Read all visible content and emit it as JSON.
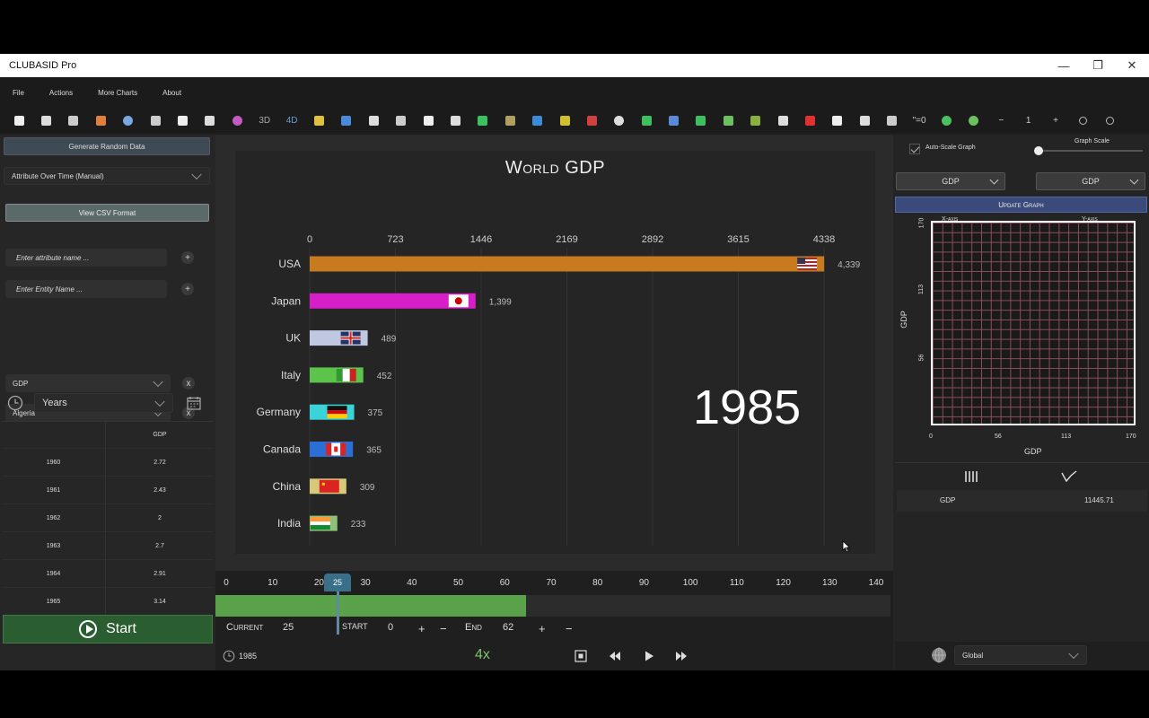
{
  "window": {
    "title": "CLUBASID Pro",
    "minimize": "—",
    "restore": "❐",
    "close": "✕"
  },
  "menu": [
    "File",
    "Actions",
    "More Charts",
    "About"
  ],
  "toolbar": {
    "text_items": {
      "t3d": "3D",
      "t4d": "4D",
      "teq0": "\"=0",
      "zoom_value": "1"
    },
    "icons": [
      "new-file-icon",
      "grid-icon",
      "text-icon",
      "bar-chart-icon",
      "pie-chart-icon",
      "horizontal-bar-icon",
      "axis-icon",
      "line-chart-icon",
      "bubble-icon",
      "3d-icon",
      "4d-icon",
      "stacked-bar-icon",
      "column-icon",
      "scatter-icon",
      "sort-icon",
      "histogram-icon",
      "pentagon-icon",
      "arc-icon",
      "map-icon",
      "bar-up-icon",
      "bar-down-icon",
      "pyramid-icon",
      "donut-icon",
      "range-icon",
      "heatmap-icon",
      "swap-icon",
      "africa-icon",
      "list-icon",
      "note-icon",
      "alert-icon",
      "wave-icon",
      "sigma-icon",
      "image-icon",
      "equals-zero-icon",
      "color-icon",
      "clock-icon",
      "minus-icon",
      "zoom-value",
      "plus-icon",
      "zoom-in-icon",
      "zoom-out-icon"
    ]
  },
  "left": {
    "generate_label": "Generate Random Data",
    "mode_select": "Attribute Over Time (Manual)",
    "csv_label": "View CSV Format",
    "attr_placeholder": "Enter attribute name ...",
    "entity_placeholder": "Enter Entity Name ...",
    "plus": "+",
    "remove": "x",
    "attr_select": "GDP",
    "entity_select": "Algeria",
    "time_unit": "Years",
    "table": {
      "headers": [
        "",
        "GDP"
      ],
      "rows": [
        [
          "1960",
          "2.72"
        ],
        [
          "1961",
          "2.43"
        ],
        [
          "1962",
          "2"
        ],
        [
          "1963",
          "2.7"
        ],
        [
          "1964",
          "2.91"
        ],
        [
          "1965",
          "3.14"
        ],
        [
          "1966",
          "3.04"
        ]
      ]
    },
    "start_label": "Start"
  },
  "chart": {
    "title": "World GDP",
    "year": "1985",
    "chart_data": {
      "type": "bar",
      "orientation": "horizontal",
      "title": "World GDP",
      "categories": [
        "USA",
        "Japan",
        "UK",
        "Italy",
        "Germany",
        "Canada",
        "China",
        "India"
      ],
      "values": [
        4339,
        1399,
        489,
        452,
        375,
        365,
        309,
        233
      ],
      "value_labels": [
        "4,339",
        "1,399",
        "489",
        "452",
        "375",
        "365",
        "309",
        "233"
      ],
      "ticks": [
        "0",
        "723",
        "1446",
        "2169",
        "2892",
        "3615",
        "4338"
      ],
      "xlim": [
        0,
        4338
      ],
      "grid": true,
      "colors": [
        "#c87a1e",
        "#d61fc8",
        "#bfc8e0",
        "#5cc44a",
        "#3ad4d8",
        "#2b6fd6",
        "#d8c87a",
        "#8fc07a"
      ],
      "flags": [
        "us-flag-icon",
        "japan-flag-icon",
        "uk-flag-icon",
        "italy-flag-icon",
        "germany-flag-icon",
        "canada-flag-icon",
        "china-flag-icon",
        "india-flag-icon"
      ]
    }
  },
  "timeline": {
    "ticks": [
      "0",
      "10",
      "20",
      "30",
      "40",
      "50",
      "60",
      "70",
      "80",
      "90",
      "100",
      "110",
      "120",
      "130",
      "140"
    ],
    "handle": "25",
    "fill_end": 65,
    "current_label": "Current",
    "current_value": "25",
    "start_label": "START",
    "start_value": "0",
    "end_label": "End",
    "end_value": "62",
    "plus": "+",
    "minus": "−",
    "year": "1985",
    "speed": "4x"
  },
  "right": {
    "autoscale_label": "Auto-Scale Graph",
    "graph_scale_label": "Graph Scale",
    "xaxis_label": "X-axis",
    "yaxis_label": "Y-axis",
    "xaxis_value": "GDP",
    "yaxis_value": "GDP",
    "update_label": "Update Graph",
    "y_ticks": [
      "170",
      "113",
      "56"
    ],
    "x_ticks": [
      "0",
      "56",
      "113",
      "170"
    ],
    "y_title": "GDP",
    "x_title": "GDP",
    "stat_name": "GDP",
    "stat_value": "11445.71",
    "region": "Global"
  }
}
